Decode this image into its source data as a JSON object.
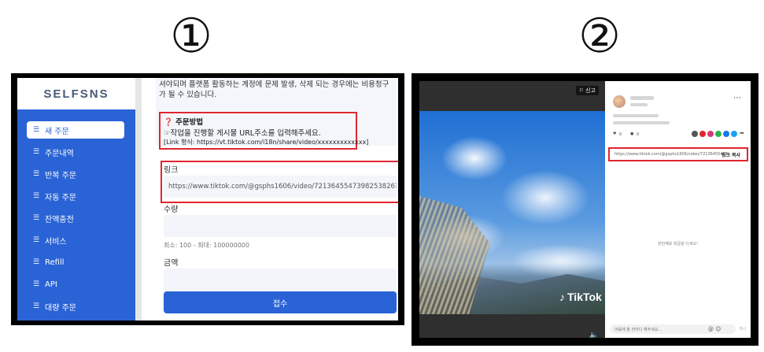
{
  "step_labels": [
    "①",
    "②"
  ],
  "panel1": {
    "logo": "SELFSNS",
    "sidebar": [
      {
        "label": "새 주문",
        "active": true
      },
      {
        "label": "주문내역"
      },
      {
        "label": "반복 주문"
      },
      {
        "label": "자동 주문"
      },
      {
        "label": "잔액충전"
      },
      {
        "label": "서비스"
      },
      {
        "label": "Refill"
      },
      {
        "label": "API"
      },
      {
        "label": "대량 주문"
      }
    ],
    "warning_text": "셔야되며 플랫폼 활동하는 계정에 문제 발생, 삭제 되는 경우에는 비용청구가 될 수 있습니다.",
    "howto": {
      "title": "❓ 주문방법",
      "instruction": "☞작업을 진행할 게시물 URL주소를 입력해주세요.",
      "format": "[Link 형식: https://vt.tiktok.com/i18n/share/video/xxxxxxxxxxxxx]"
    },
    "link": {
      "label": "링크",
      "value": "https://www.tiktok.com/@gsphs1606/video/7213645547398253826?is_fro"
    },
    "quantity": {
      "label": "수량",
      "value": "",
      "hint": "최소: 100 - 최대: 100000000"
    },
    "amount": {
      "label": "금액",
      "value": ""
    },
    "submit": "접수"
  },
  "panel2": {
    "report": "⚐ 신고",
    "brand": "TikTok",
    "like_count": "0",
    "comment_count": "0",
    "link_url": "https://www.tiktok.com/@gsphs1606/video/72136455473...",
    "copy_label": "링크 복사",
    "empty_comments": "첫번째로 댓글을 다세요!",
    "comment_placeholder": "마음에 들 한마디 해주세요...",
    "post_label": "게시",
    "accent": "#e0262f"
  }
}
